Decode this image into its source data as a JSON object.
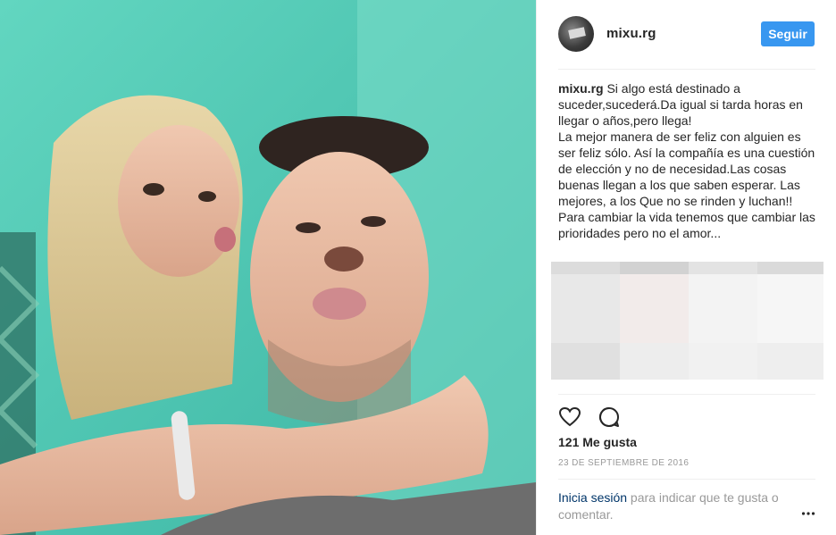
{
  "post": {
    "username": "mixu.rg",
    "follow_label": "Seguir",
    "caption_author": "mixu.rg",
    "caption_text": " Si algo está destinado a suceder,sucederá.Da igual si tarda horas en llegar o años,pero llega!\nLa mejor manera de ser feliz con alguien es ser feliz sólo. Así la compañía es una cuestión de elección y no de necesidad.Las cosas buenas llegan a los que saben esperar. Las mejores, a los Que no se rinden y luchan!! Para cambiar la vida tenemos que cambiar las prioridades pero no el amor...",
    "likes_text": "121 Me gusta",
    "date_text": "23 de septiembre de 2016",
    "login_link": "Inicia sesión",
    "login_rest": " para indicar que te gusta o comentar."
  },
  "icons": {
    "like": "heart-icon",
    "comment": "comment-icon",
    "more": "more-options-icon",
    "avatar": "profile-avatar"
  },
  "colors": {
    "accent": "#3897f0",
    "link": "#003569",
    "muted": "#999999",
    "photo_tint": "#4fc8b4"
  }
}
